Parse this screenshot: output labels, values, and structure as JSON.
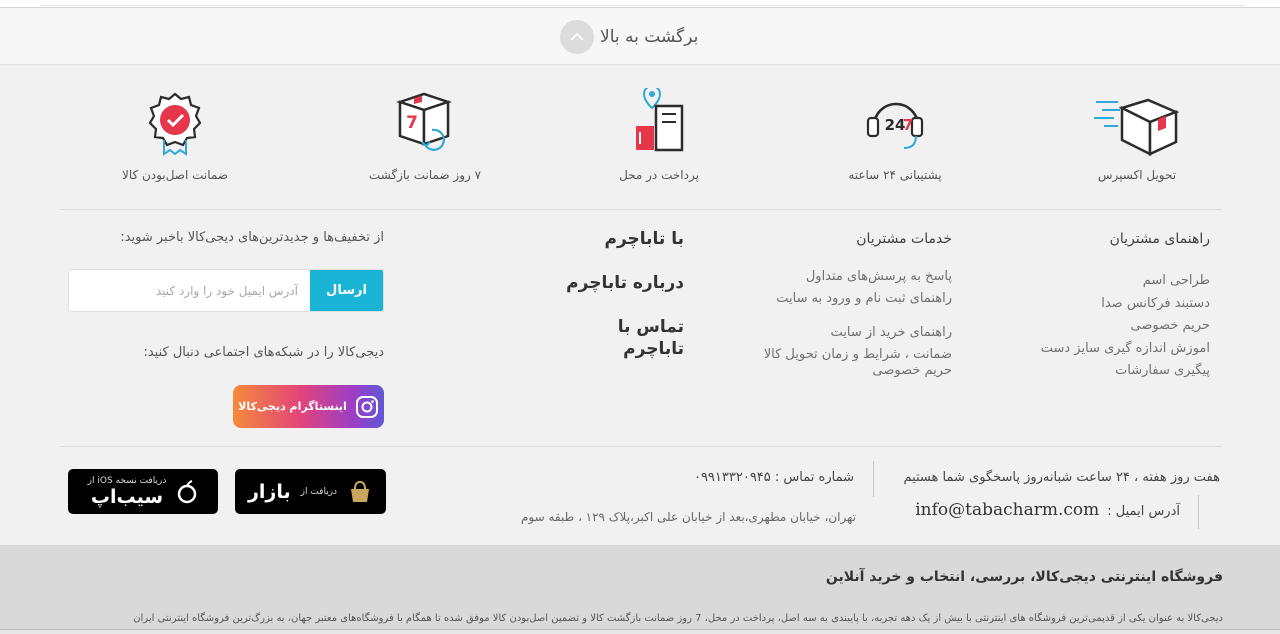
{
  "back_to_top": {
    "label": "برگشت به بالا"
  },
  "features": [
    {
      "label": "تحویل اکسپرس",
      "icon": "express-delivery-icon"
    },
    {
      "label": "پشتیبانی ۲۴ ساعته",
      "icon": "support-24-7-icon"
    },
    {
      "label": "پرداخت در محل",
      "icon": "pay-on-delivery-icon"
    },
    {
      "label": "۷ روز ضمانت بازگشت",
      "icon": "seven-day-return-icon"
    },
    {
      "label": "ضمانت اصل‌بودن کالا",
      "icon": "original-guarantee-icon"
    }
  ],
  "guide": {
    "title": "راهنمای مشتریان",
    "items": [
      "طراحی اسم",
      "دستبند فرکانس صدا",
      "حریم خصوصی",
      "اموزش اندازه گیری سایز دست",
      "پیگیری سفارشات"
    ]
  },
  "services": {
    "title": "خدمات مشتریان",
    "items": [
      "پاسخ به پرسش‌های متداول",
      "راهنمای ثبت نام و ورود به سایت",
      "",
      "راهنمای خرید از سایت",
      "ضمانت ، شرایط و زمان تحویل کالا",
      "حریم خصوصی"
    ]
  },
  "with_us": {
    "title": "با تاباچرم",
    "items": [
      "درباره تاباچرم",
      "تماس با تاباچرم"
    ]
  },
  "newsletter": {
    "label": "از تخفیف‌ها و جدیدترین‌های دیجی‌کالا باخبر شوید:",
    "placeholder": "آدرس ایمیل خود را وارد کنید",
    "button": "ارسال",
    "social_label": "دیجی‌کالا را در شبکه‌های اجتماعی دنبال کنید:",
    "instagram": "اینستاگرام دیجی‌کالا"
  },
  "contact": {
    "hours": "هفت روز هفته ، ۲۴ ساعت شبانه‌روز پاسخگوی شما هستیم",
    "phone_label": "شماره تماس :",
    "phone": "۰۹۹۱۳۳۲۰۹۴۵",
    "email_label": "آدرس ایمیل :",
    "email": "info@tabacharm.com",
    "address": "تهران، خیابان مطهری،بعد از خیابان علی اکبر،پلاک ۱۲۹ ، طبقه سوم"
  },
  "apps": {
    "bazaar_small": "دریافت از",
    "bazaar_big": "بازار",
    "sibapp_small": "دریافت نسخه iOS از",
    "sibapp_big": "سیب‌اپ"
  },
  "about": {
    "title": "فروشگاه اینترنتی دیجی‌کالا، بررسی، انتخاب و خرید آنلاین",
    "text": "دیجی‌کالا به عنوان یکی از قدیمی‌ترین فروشگاه های اینترنتی با بیش از یک دهه تجربه، با پایبندی به سه اصل، پرداخت در محل، 7 روز ضمانت بازگشت کالا و تضمین اصل‌بودن کالا موفق شده تا همگام با فروشگاه‌های معتبر جهان، به بزرگ‌ترین فروشگاه اینترنتی ایران"
  },
  "colors": {
    "accent": "#1ab5d6",
    "icon_red": "#e6364c",
    "icon_blue": "#2fa8d8",
    "icon_dark": "#2b2b2b"
  }
}
